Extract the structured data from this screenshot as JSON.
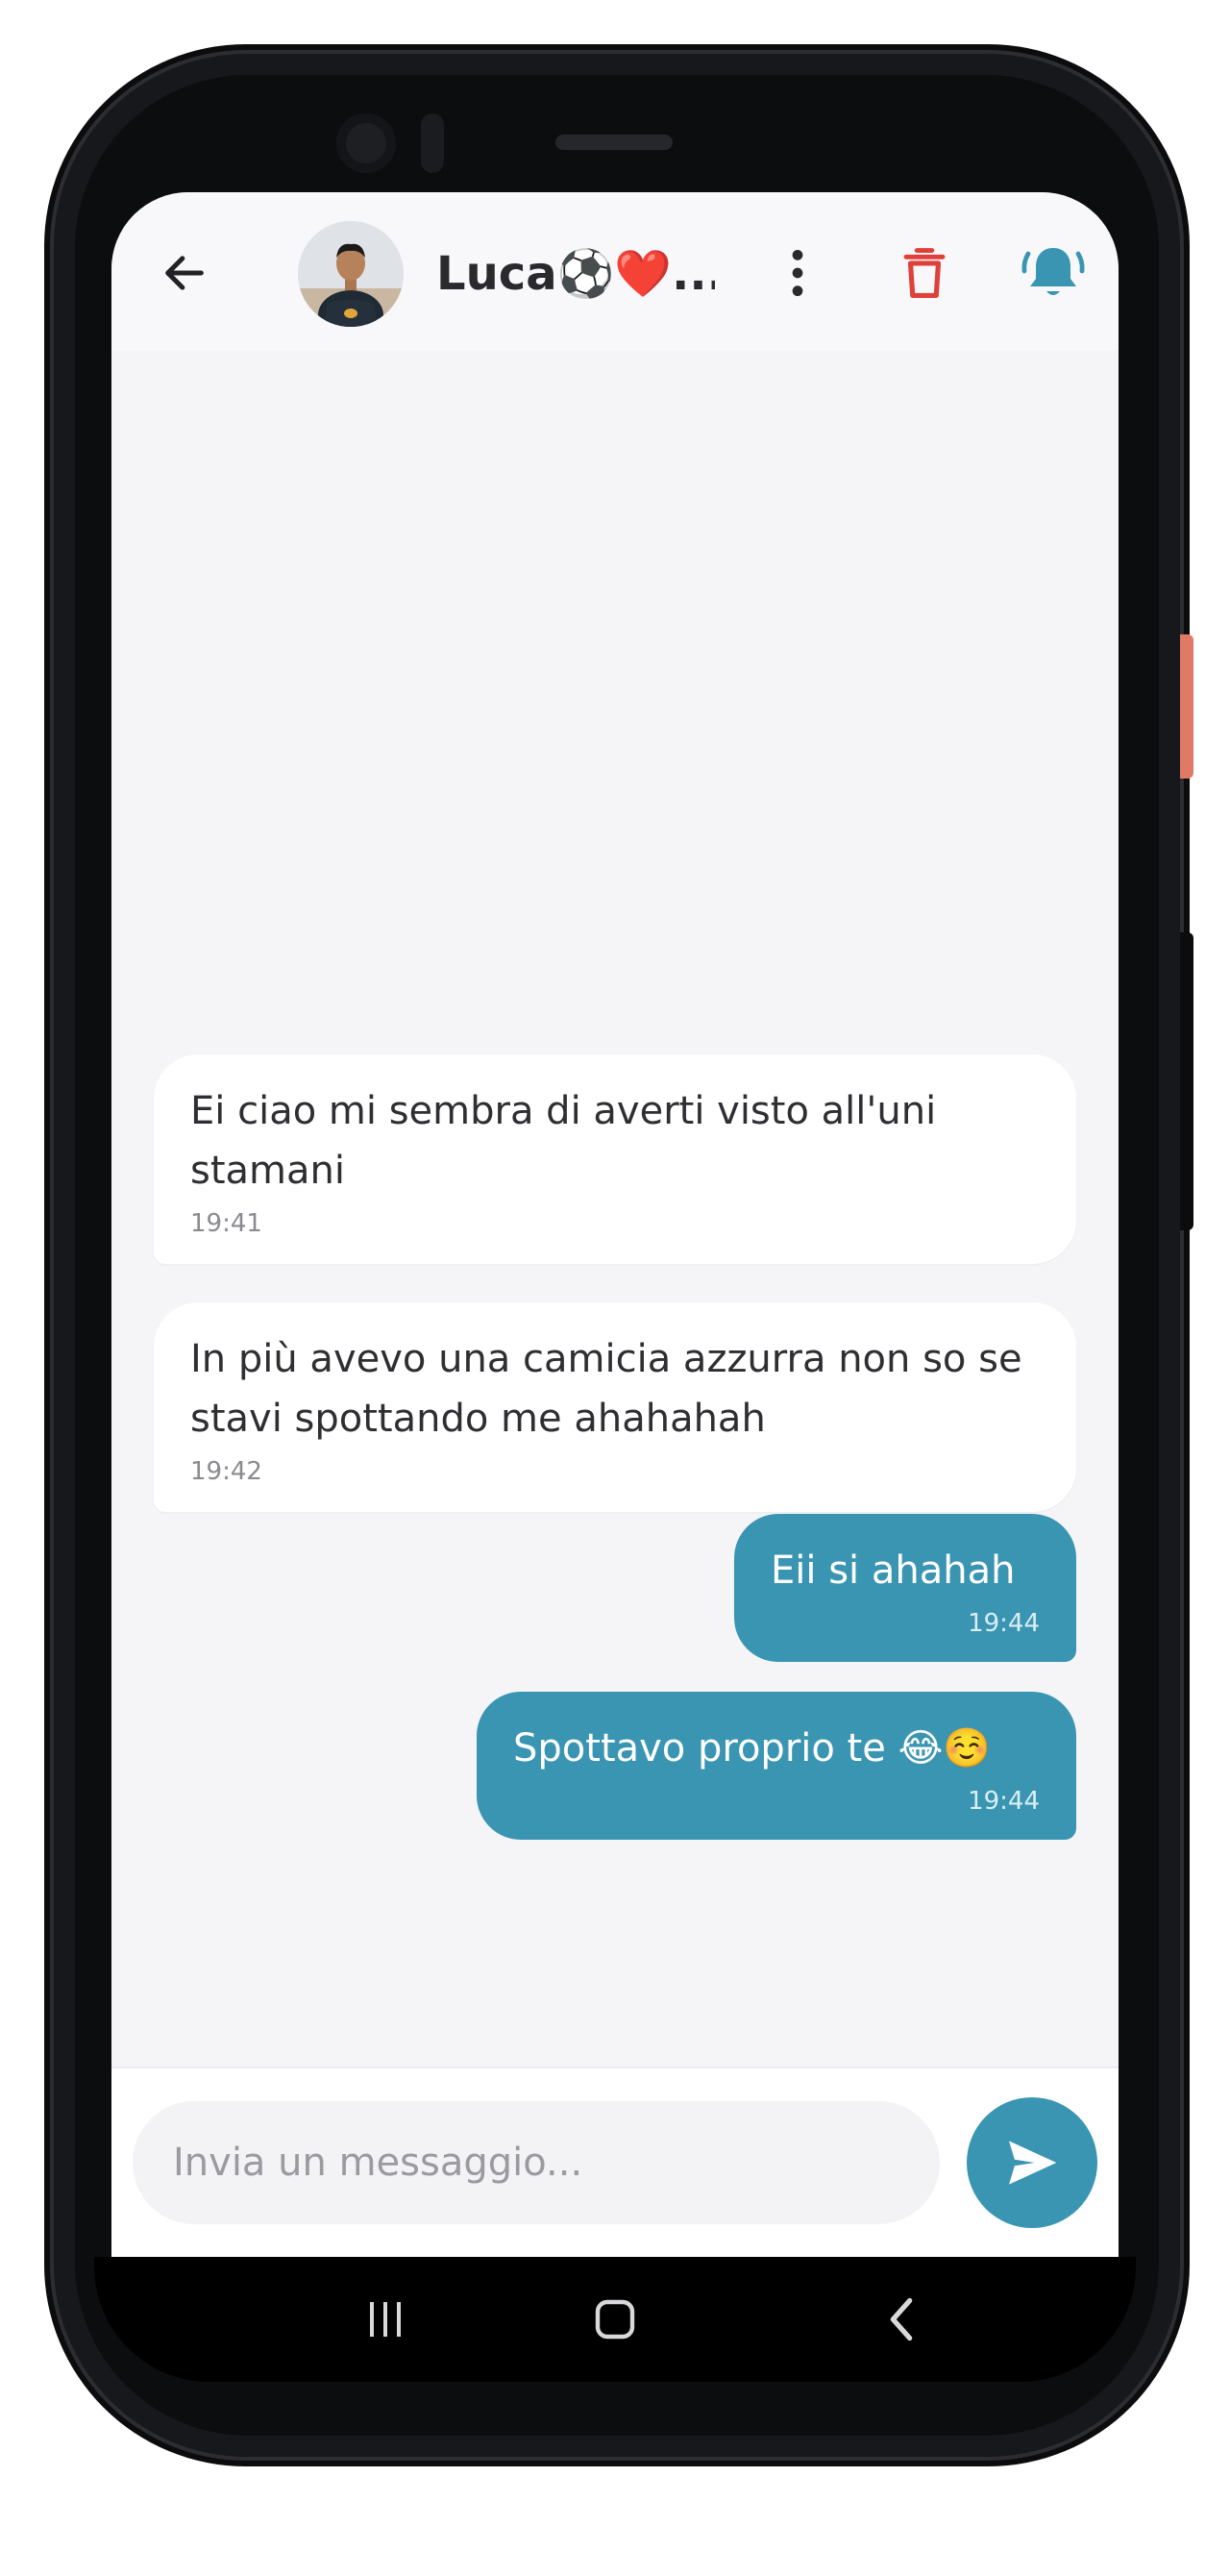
{
  "header": {
    "contact_name": "Luca⚽❤️...",
    "icons": {
      "back": "arrow-left-icon",
      "menu": "more-vertical-icon",
      "delete": "trash-icon",
      "notifications": "bell-ringing-icon"
    }
  },
  "messages": [
    {
      "direction": "incoming",
      "text": "Ei ciao mi sembra di averti visto all'uni stamani",
      "time": "19:41"
    },
    {
      "direction": "incoming",
      "text": "In più avevo una camicia azzurra non so se stavi spottando me ahahahah",
      "time": "19:42"
    },
    {
      "direction": "outgoing",
      "text": "Eii si ahahah",
      "time": "19:44"
    },
    {
      "direction": "outgoing",
      "text": "Spottavo proprio te 😂☺️",
      "time": "19:44"
    }
  ],
  "composer": {
    "placeholder": "Invia un messaggio...",
    "value": "",
    "send_icon": "send-icon"
  },
  "system_nav": {
    "icons": [
      "recent-apps-icon",
      "home-icon",
      "back-nav-icon"
    ]
  },
  "colors": {
    "accent": "#3a95b3",
    "delete": "#e0403a",
    "screen_background": "#f5f5f8",
    "incoming_bubble": "#ffffff",
    "outgoing_bubble": "#3a95b3",
    "side_button": "#e07a66"
  }
}
